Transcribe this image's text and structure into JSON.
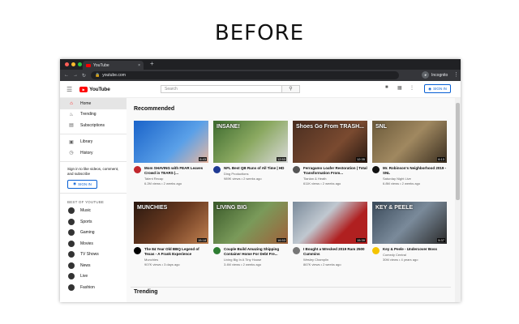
{
  "heading": "BEFORE",
  "browser": {
    "tab_title": "YouTube",
    "tab_close": "×",
    "new_tab": "+",
    "url": "youtube.com",
    "incognito_label": "Incognito",
    "back": "←",
    "forward": "→",
    "reload": "↻",
    "lock": "🔒",
    "menu": "⋮"
  },
  "youtube": {
    "logo_text": "YouTube",
    "search_placeholder": "Search",
    "search_icon": "⚲",
    "signin_label": "SIGN IN"
  },
  "sidebar": {
    "main_items": [
      {
        "label": "Home",
        "icon": "home-icon",
        "glyph": "⌂",
        "active": true
      },
      {
        "label": "Trending",
        "icon": "trending-icon",
        "glyph": "♨",
        "active": false
      },
      {
        "label": "Subscriptions",
        "icon": "subscriptions-icon",
        "glyph": "▤",
        "active": false
      }
    ],
    "library_items": [
      {
        "label": "Library",
        "icon": "library-icon",
        "glyph": "▣"
      },
      {
        "label": "History",
        "icon": "history-icon",
        "glyph": "◷"
      }
    ],
    "signin_text": "Sign in to like videos, comment, and subscribe",
    "signin_button": "SIGN IN",
    "best_of_title": "BEST OF YOUTUBE",
    "best_of_items": [
      {
        "label": "Music",
        "color": "#333333"
      },
      {
        "label": "Sports",
        "color": "#333333"
      },
      {
        "label": "Gaming",
        "color": "#333333"
      },
      {
        "label": "Movies",
        "color": "#333333"
      },
      {
        "label": "TV Shows",
        "color": "#333333"
      },
      {
        "label": "News",
        "color": "#333333"
      },
      {
        "label": "Live",
        "color": "#333333"
      },
      {
        "label": "Fashion",
        "color": "#333333"
      }
    ]
  },
  "main": {
    "recommended_title": "Recommended",
    "trending_title": "Trending",
    "videos": [
      {
        "title": "Mom SHAVING with FEAR Leaves Crowd in TEARS |...",
        "channel": "Talent Recap",
        "stats": "6.2M views • 2 weeks ago",
        "duration": "6:43",
        "overlay": "",
        "bg": "linear-gradient(135deg,#1a63c9,#5aa0e8 60%,#e8b7a0)",
        "avatar": "#c1272d"
      },
      {
        "title": "NFL Best QB Runs of All Time | HD",
        "channel": "Ding Productions",
        "stats": "989K views • 2 weeks ago",
        "duration": "12:53",
        "overlay": "INSANE!",
        "bg": "linear-gradient(135deg,#3d6b2f,#8aa860 50%,#d9d9d9)",
        "avatar": "#1f3a93"
      },
      {
        "title": "Ferragamo Loafer Restoration | Total Transformation From...",
        "channel": "Tianlan & Heath",
        "stats": "611K views • 2 weeks ago",
        "duration": "12:35",
        "overlay": "Shoes Go From TRASH...",
        "bg": "linear-gradient(135deg,#4a2e20,#7a4a30 60%,#2a1a12)",
        "avatar": "#555555"
      },
      {
        "title": "Mr. Robinson's Neighborhood 2019 - SNL",
        "channel": "Saturday Night Live",
        "stats": "6.8M views • 2 weeks ago",
        "duration": "6:13",
        "overlay": "SNL",
        "bg": "linear-gradient(135deg,#6b5a3a,#a08860 50%,#3a2e20)",
        "avatar": "#111111"
      },
      {
        "title": "The 84 Year Old BBQ Legend of Texas - A Frank Experience",
        "channel": "Munchies",
        "stats": "907K views • 3 days ago",
        "duration": "15:18",
        "overlay": "MUNCHIES",
        "bg": "linear-gradient(135deg,#2a1810,#6a3a20 50%,#c08050)",
        "avatar": "#000000"
      },
      {
        "title": "Couple Build Amazing Shipping Container Home For Debt Fre...",
        "channel": "Living Big In A Tiny House",
        "stats": "3.4M views • 2 weeks ago",
        "duration": "16:53",
        "overlay": "LIVING BIG",
        "bg": "linear-gradient(135deg,#3a5a2a,#7a9a5a 50%,#a0603a)",
        "avatar": "#2e7d32"
      },
      {
        "title": "I Bought a Wrecked 2019 Ram 2500 Cummins",
        "channel": "Wesley Champlin",
        "stats": "867K views • 2 weeks ago",
        "duration": "15:39",
        "overlay": "",
        "bg": "linear-gradient(135deg,#7a8a9a,#c0c8d0 40%,#b02020 70%)",
        "avatar": "#777777"
      },
      {
        "title": "Key & Peele - Undercover Boss",
        "channel": "Comedy Central",
        "stats": "30M views • 4 years ago",
        "duration": "5:37",
        "overlay": "KEY & PEELE",
        "bg": "linear-gradient(135deg,#3a4a5a,#7a8a9a 50%,#2a2a2a)",
        "avatar": "#f5c400"
      }
    ]
  }
}
